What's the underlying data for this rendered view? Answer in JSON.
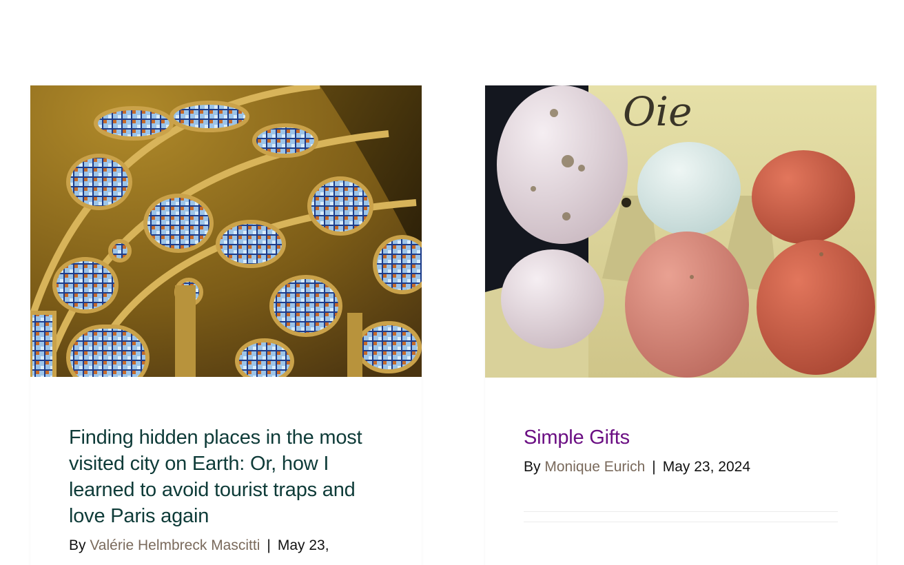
{
  "posts": [
    {
      "image_alt": "Gothic rose window with stained glass",
      "title": "Finding hidden places in the most visited city on Earth: Or, how I learned to avoid tourist traps and love Paris again",
      "by_label": "By",
      "author": "Valérie Helmbreck Mascitti",
      "separator": "|",
      "date": "May 23,",
      "title_color": "#0e3b38"
    },
    {
      "image_alt": "Eggs of various colors in a cardboard carton labeled Oie",
      "title": "Simple Gifts",
      "by_label": "By",
      "author": "Monique Eurich",
      "separator": "|",
      "date": "May 23, 2024",
      "title_color": "#6b0f83",
      "carton_label": "Oie"
    }
  ],
  "colors": {
    "author_link": "#7a6a5c",
    "background": "#ffffff"
  }
}
